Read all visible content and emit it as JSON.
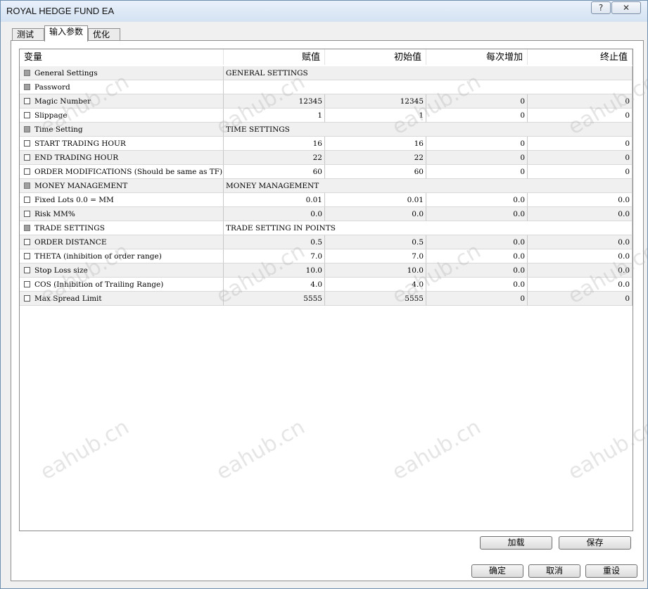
{
  "window": {
    "title": "ROYAL HEDGE FUND EA",
    "help_label": "?",
    "close_label": "✕"
  },
  "tabs": [
    {
      "label": "测试"
    },
    {
      "label": "输入参数"
    },
    {
      "label": "优化"
    }
  ],
  "table": {
    "columns": [
      "变量",
      "赋值",
      "初始值",
      "每次增加",
      "终止值"
    ],
    "rows": [
      {
        "name": "General Settings",
        "value": "GENERAL SETTINGS",
        "start": "",
        "step": "",
        "stop": "",
        "section": true
      },
      {
        "name": "Password",
        "value": "",
        "start": "",
        "step": "",
        "stop": "",
        "section": true
      },
      {
        "name": "Magic Number",
        "value": "12345",
        "start": "12345",
        "step": "0",
        "stop": "0",
        "section": false
      },
      {
        "name": "Slippage",
        "value": "1",
        "start": "1",
        "step": "0",
        "stop": "0",
        "section": false
      },
      {
        "name": "Time Setting",
        "value": "TIME SETTINGS",
        "start": "",
        "step": "",
        "stop": "",
        "section": true
      },
      {
        "name": "START TRADING HOUR",
        "value": "16",
        "start": "16",
        "step": "0",
        "stop": "0",
        "section": false
      },
      {
        "name": "END TRADING HOUR",
        "value": "22",
        "start": "22",
        "step": "0",
        "stop": "0",
        "section": false
      },
      {
        "name": "ORDER MODIFICATIONS (Should be same as TF)",
        "value": "60",
        "start": "60",
        "step": "0",
        "stop": "0",
        "section": false
      },
      {
        "name": "MONEY MANAGEMENT",
        "value": "MONEY MANAGEMENT",
        "start": "",
        "step": "",
        "stop": "",
        "section": true
      },
      {
        "name": "Fixed Lots 0.0 = MM",
        "value": "0.01",
        "start": "0.01",
        "step": "0.0",
        "stop": "0.0",
        "section": false
      },
      {
        "name": "Risk MM%",
        "value": "0.0",
        "start": "0.0",
        "step": "0.0",
        "stop": "0.0",
        "section": false
      },
      {
        "name": "TRADE SETTINGS",
        "value": "TRADE SETTING IN POINTS",
        "start": "",
        "step": "",
        "stop": "",
        "section": true
      },
      {
        "name": "ORDER DISTANCE",
        "value": "0.5",
        "start": "0.5",
        "step": "0.0",
        "stop": "0.0",
        "section": false
      },
      {
        "name": "THETA (inhibition of order range)",
        "value": "7.0",
        "start": "7.0",
        "step": "0.0",
        "stop": "0.0",
        "section": false
      },
      {
        "name": "Stop Loss size",
        "value": "10.0",
        "start": "10.0",
        "step": "0.0",
        "stop": "0.0",
        "section": false
      },
      {
        "name": "COS (Inhibition of Trailing Range)",
        "value": "4.0",
        "start": "4.0",
        "step": "0.0",
        "stop": "0.0",
        "section": false
      },
      {
        "name": "Max Spread Limit",
        "value": "5555",
        "start": "5555",
        "step": "0",
        "stop": "0",
        "section": false
      }
    ]
  },
  "buttons": {
    "load": "加载",
    "save": "保存",
    "ok": "确定",
    "cancel": "取消",
    "reset": "重设"
  },
  "watermark": "eahub.cn",
  "colors": {
    "title_bar": "#d4e2f2",
    "row_alt": "#f0f0f0",
    "section_checkbox": "#a0a0a0"
  }
}
